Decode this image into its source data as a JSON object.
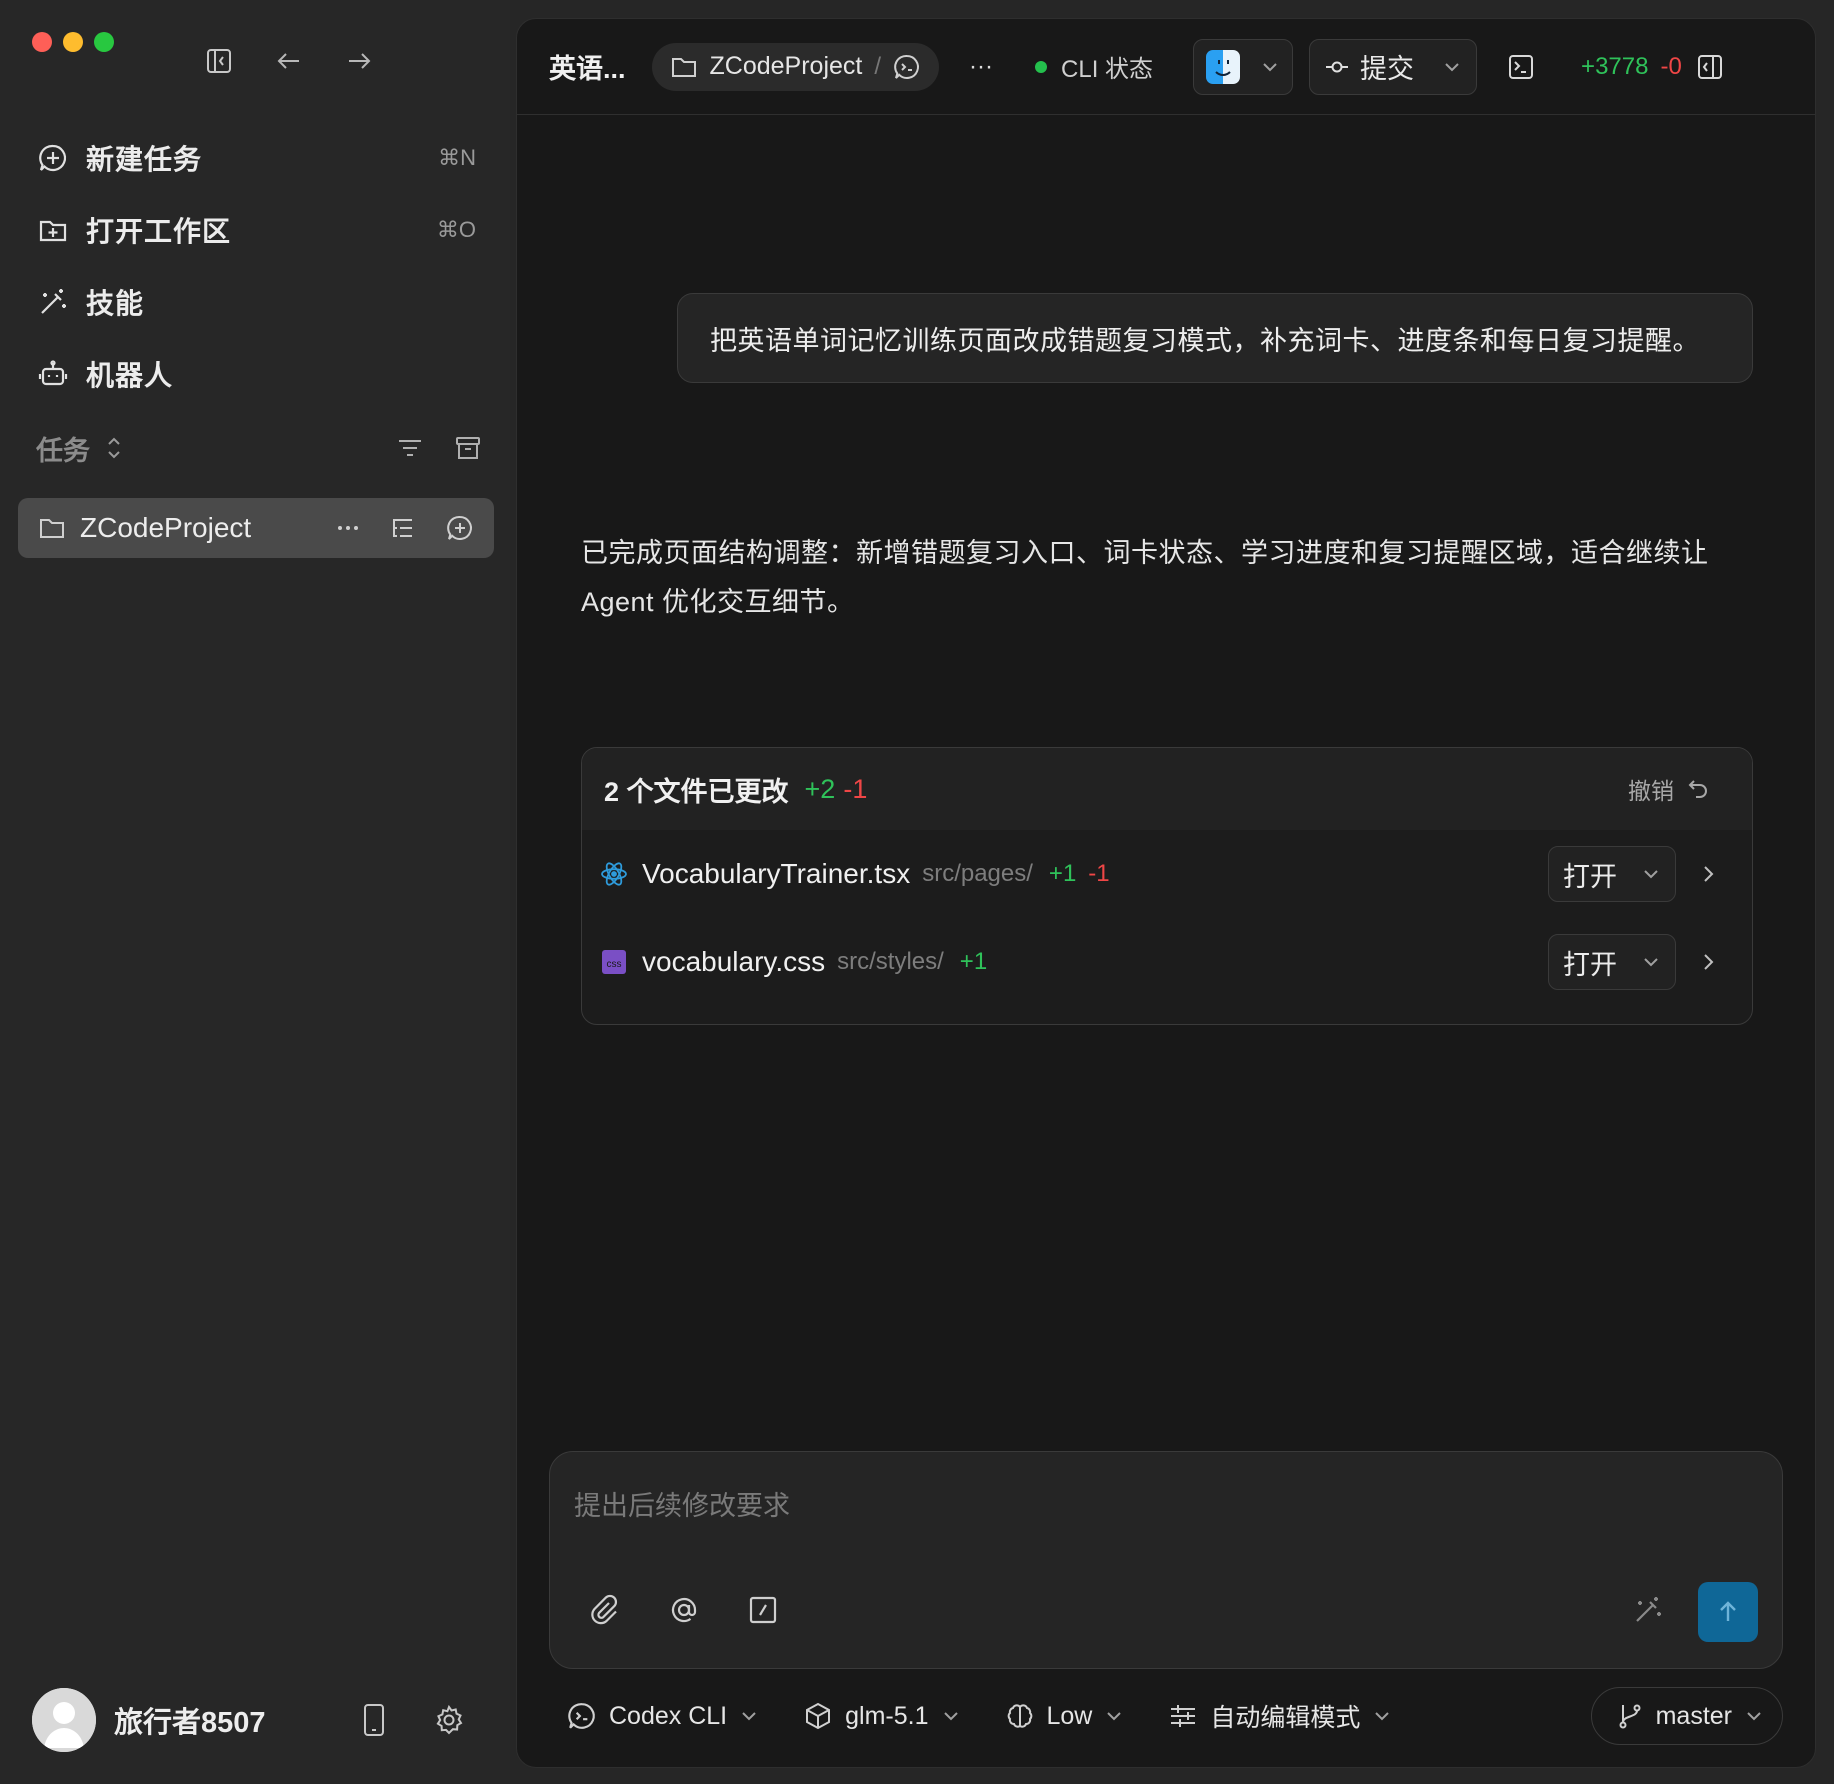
{
  "sidebar": {
    "menu": [
      {
        "label": "新建任务",
        "shortcut": "⌘N",
        "icon": "new-task-icon"
      },
      {
        "label": "打开工作区",
        "shortcut": "⌘O",
        "icon": "open-folder-icon"
      },
      {
        "label": "技能",
        "shortcut": "",
        "icon": "magic-wand-icon"
      },
      {
        "label": "机器人",
        "shortcut": "",
        "icon": "robot-icon"
      }
    ],
    "tasks_label": "任务",
    "project": {
      "label": "ZCodeProject"
    },
    "user": {
      "name": "旅行者8507"
    }
  },
  "topbar": {
    "title": "英语...",
    "project_chip": "ZCodeProject",
    "chip_sep": "/",
    "more": "···",
    "status_label": "CLI 状态",
    "status_color": "#24c04d",
    "commit_label": "提交",
    "additions": "+3778",
    "deletions": "-0"
  },
  "chat": {
    "user_message": "把英语单词记忆训练页面改成错题复习模式，补充词卡、进度条和每日复习提醒。",
    "reply": "已完成页面结构调整：新增错题复习入口、词卡状态、学习进度和复习提醒区域，适合继续让 Agent 优化交互细节。"
  },
  "changes": {
    "title": "2 个文件已更改",
    "additions": "+2",
    "deletions": "-1",
    "undo_label": "撤销",
    "files": [
      {
        "name": "VocabularyTrainer.tsx",
        "path": "src/pages/",
        "additions": "+1",
        "deletions": "-1",
        "open_label": "打开",
        "icon": "react-icon"
      },
      {
        "name": "vocabulary.css",
        "path": "src/styles/",
        "additions": "+1",
        "deletions": "",
        "open_label": "打开",
        "icon": "css-file-icon"
      }
    ]
  },
  "composer": {
    "placeholder": "提出后续修改要求"
  },
  "bottom_bar": {
    "agent": "Codex CLI",
    "model": "glm-5.1",
    "effort": "Low",
    "mode": "自动编辑模式",
    "branch": "master"
  },
  "colors": {
    "accent_send": "#0f6797",
    "add_green": "#2fc25a",
    "delete_red": "#ef4646"
  }
}
